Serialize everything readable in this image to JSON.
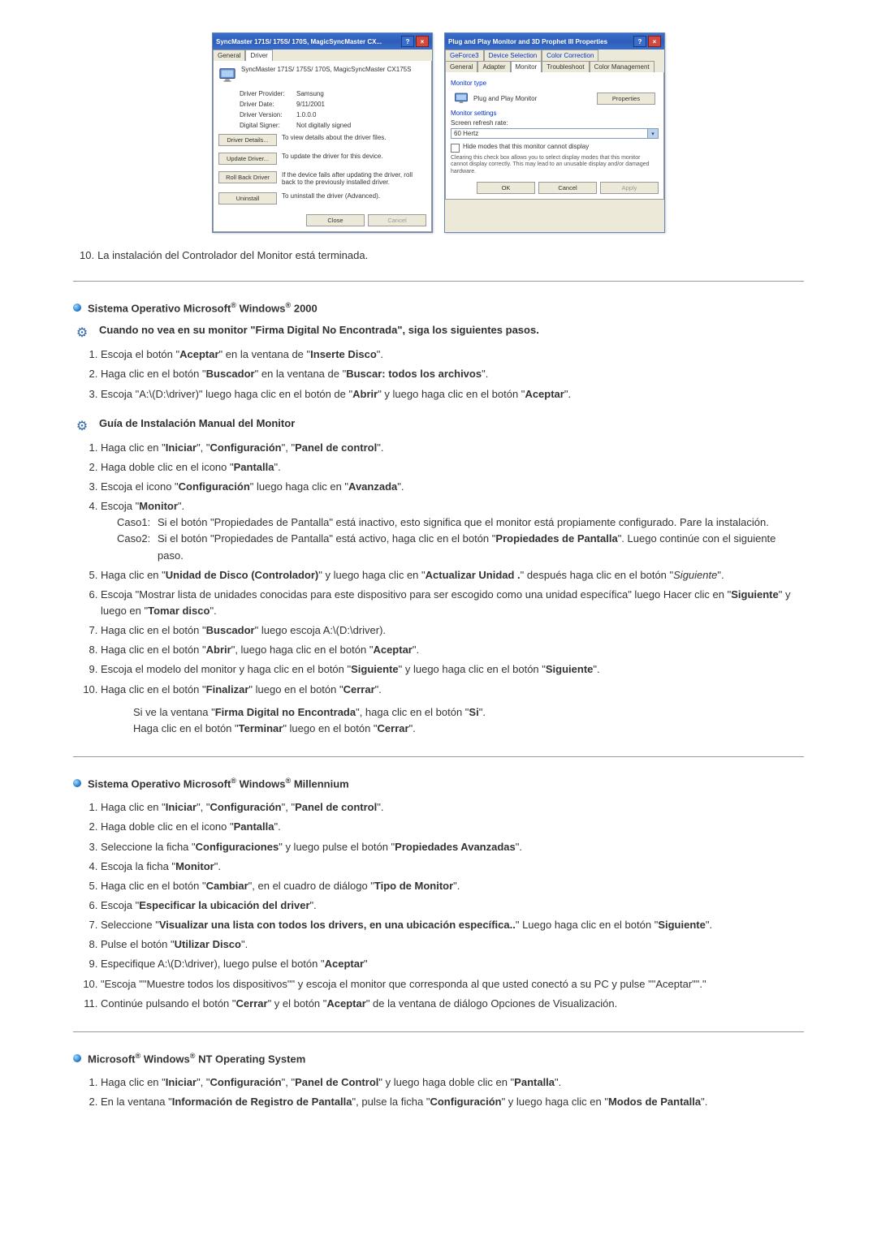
{
  "dlg1": {
    "title": "SyncMaster 171S/ 175S/ 170S, MagicSyncMaster CX...",
    "tabs": [
      "General",
      "Driver"
    ],
    "device": "SyncMaster 171S/ 175S/ 170S, MagicSyncMaster CX175S",
    "rows": {
      "provider_l": "Driver Provider:",
      "provider_v": "Samsung",
      "date_l": "Driver Date:",
      "date_v": "9/11/2001",
      "ver_l": "Driver Version:",
      "ver_v": "1.0.0.0",
      "signer_l": "Digital Signer:",
      "signer_v": "Not digitally signed"
    },
    "buttons": {
      "details": "Driver Details...",
      "details_d": "To view details about the driver files.",
      "update": "Update Driver...",
      "update_d": "To update the driver for this device.",
      "roll": "Roll Back Driver",
      "roll_d": "If the device fails after updating the driver, roll back to the previously installed driver.",
      "uninstall": "Uninstall",
      "uninstall_d": "To uninstall the driver (Advanced)."
    },
    "close": "Close",
    "cancel": "Cancel"
  },
  "dlg2": {
    "title": "Plug and Play Monitor and 3D Prophet III Properties",
    "tabs": [
      "GeForce3",
      "Device Selection",
      "Color Correction",
      "General",
      "Adapter",
      "Monitor",
      "Troubleshoot",
      "Color Management"
    ],
    "g_type": "Monitor type",
    "mon_name": "Plug and Play Monitor",
    "props": "Properties",
    "g_settings": "Monitor settings",
    "refresh_l": "Screen refresh rate:",
    "refresh_v": "60 Hertz",
    "hide": "Hide modes that this monitor cannot display",
    "warn": "Clearing this check box allows you to select display modes that this monitor cannot display correctly. This may lead to an unusable display and/or damaged hardware.",
    "ok": "OK",
    "cancel": "Cancel",
    "apply": "Apply"
  },
  "step10": {
    "n": "10.",
    "t": "La instalación del Controlador del Monitor está terminada."
  },
  "s2000": {
    "title_pre": "Sistema Operativo Microsoft",
    "title_os": " Windows",
    "title_suf": " 2000",
    "warn_a": "Cuando no vea en su monitor \"Firma Digital No Encontrada\", siga los siguientes pasos.",
    "s1_a": "Escoja el botón \"",
    "s1_b": "Aceptar",
    "s1_c": "\" en la ventana de \"",
    "s1_d": "Inserte Disco",
    "s1_e": "\".",
    "s2_a": "Haga clic en el botón \"",
    "s2_b": "Buscador",
    "s2_c": "\" en la ventana de \"",
    "s2_d": "Buscar: todos los archivos",
    "s2_e": "\".",
    "s3_a": "Escoja \"A:\\(D:\\driver)\" luego haga clic en el botón de \"",
    "s3_b": "Abrir",
    "s3_c": "\" y luego haga clic en el botón \"",
    "s3_d": "Aceptar",
    "s3_e": "\".",
    "guide": "Guía de Instalación Manual del Monitor",
    "g1_a": "Haga clic en \"",
    "g1_b": "Iniciar",
    "g1_c": "\", \"",
    "g1_d": "Configuración",
    "g1_e": "\", \"",
    "g1_f": "Panel de control",
    "g1_g": "\".",
    "g2_a": "Haga doble clic en el icono \"",
    "g2_b": "Pantalla",
    "g2_c": "\".",
    "g3_a": "Escoja el icono \"",
    "g3_b": "Configuración",
    "g3_c": "\" luego haga clic en \"",
    "g3_d": "Avanzada",
    "g3_e": "\".",
    "g4_a": "Escoja \"",
    "g4_b": "Monitor",
    "g4_c": "\".",
    "c1_l": "Caso1:",
    "c1_t": "Si el botón \"Propiedades de Pantalla\" está inactivo, esto significa que el monitor está propiamente configurado. Pare la instalación.",
    "c2_l": "Caso2:",
    "c2_a": "Si el botón \"Propiedades de Pantalla\" está activo, haga clic en el botón \"",
    "c2_b": "Propiedades de Pantalla",
    "c2_c": "\". Luego continúe con el siguiente paso.",
    "g5_a": "Haga clic en \"",
    "g5_b": "Unidad de Disco (Controlador)",
    "g5_c": "\" y luego haga clic en \"",
    "g5_d": "Actualizar Unidad .",
    "g5_e": "\" después haga clic en el botón \"",
    "g5_f": "Siguiente",
    "g5_g": "\".",
    "g6_a": "Escoja \"Mostrar lista de unidades conocidas para este dispositivo para ser escogido como una unidad específica\" luego Hacer clic en \"",
    "g6_b": "Siguiente",
    "g6_c": "\" y luego en \"",
    "g6_d": "Tomar disco",
    "g6_e": "\".",
    "g7_a": "Haga clic en el botón \"",
    "g7_b": "Buscador",
    "g7_c": "\" luego escoja A:\\(D:\\driver).",
    "g8_a": "Haga clic en el botón \"",
    "g8_b": "Abrir",
    "g8_c": "\", luego haga clic en el botón \"",
    "g8_d": "Aceptar",
    "g8_e": "\".",
    "g9_a": "Escoja el modelo del monitor y haga clic en el botón \"",
    "g9_b": "Siguiente",
    "g9_c": "\" y luego haga clic en el botón \"",
    "g9_d": "Siguiente",
    "g9_e": "\".",
    "g10_a": "Haga clic en el botón \"",
    "g10_b": "Finalizar",
    "g10_c": "\" luego en el botón \"",
    "g10_d": "Cerrar",
    "g10_e": "\".",
    "n1_a": "Si ve la ventana \"",
    "n1_b": "Firma Digital no Encontrada",
    "n1_c": "\", haga clic en el botón \"",
    "n1_d": "Si",
    "n1_e": "\".",
    "n2_a": "Haga clic en el botón \"",
    "n2_b": "Terminar",
    "n2_c": "\" luego en el botón \"",
    "n2_d": "Cerrar",
    "n2_e": "\"."
  },
  "sme": {
    "title_pre": "Sistema Operativo Microsoft",
    "title_os": " Windows",
    "title_suf": " Millennium",
    "s1_a": "Haga clic en \"",
    "s1_b": "Iniciar",
    "s1_c": "\", \"",
    "s1_d": "Configuración",
    "s1_e": "\", \"",
    "s1_f": "Panel de control",
    "s1_g": "\".",
    "s2_a": "Haga doble clic en el icono \"",
    "s2_b": "Pantalla",
    "s2_c": "\".",
    "s3_a": "Seleccione la ficha \"",
    "s3_b": "Configuraciones",
    "s3_c": "\" y luego pulse el botón \"",
    "s3_d": "Propiedades Avanzadas",
    "s3_e": "\".",
    "s4_a": "Escoja la ficha \"",
    "s4_b": "Monitor",
    "s4_c": "\".",
    "s5_a": "Haga clic en el botón \"",
    "s5_b": "Cambiar",
    "s5_c": "\", en el cuadro de diálogo \"",
    "s5_d": "Tipo de Monitor",
    "s5_e": "\".",
    "s6_a": "Escoja \"",
    "s6_b": "Especificar la ubicación del driver",
    "s6_c": "\".",
    "s7_a": "Seleccione \"",
    "s7_b": "Visualizar una lista con todos los drivers, en una ubicación específica..",
    "s7_c": "\" Luego haga clic en el botón \"",
    "s7_d": "Siguiente",
    "s7_e": "\".",
    "s8_a": "Pulse el botón \"",
    "s8_b": "Utilizar Disco",
    "s8_c": "\".",
    "s9_a": "Especifique A:\\(D:\\driver), luego pulse el botón \"",
    "s9_b": "Aceptar",
    "s9_c": "\"",
    "s10": "\"Escoja \"\"Muestre todos los dispositivos\"\" y escoja el monitor que corresponda al que usted conectó a su PC y pulse \"\"Aceptar\"\".\"",
    "s11_a": "Continúe pulsando el botón \"",
    "s11_b": "Cerrar",
    "s11_c": "\" y el botón \"",
    "s11_d": "Aceptar",
    "s11_e": "\" de la ventana de diálogo Opciones de Visualización."
  },
  "snt": {
    "title_pre": "Microsoft",
    "title_os": " Windows",
    "title_suf": " NT Operating System",
    "s1_a": "Haga clic en \"",
    "s1_b": "Iniciar",
    "s1_c": "\", \"",
    "s1_d": "Configuración",
    "s1_e": "\", \"",
    "s1_f": "Panel de Control",
    "s1_g": "\" y luego haga doble clic en \"",
    "s1_h": "Pantalla",
    "s1_i": "\".",
    "s2_a": "En la ventana \"",
    "s2_b": "Información de Registro de Pantalla",
    "s2_c": "\", pulse la ficha \"",
    "s2_d": "Configuración",
    "s2_e": "\" y luego haga clic en \"",
    "s2_f": "Modos de Pantalla",
    "s2_g": "\"."
  }
}
